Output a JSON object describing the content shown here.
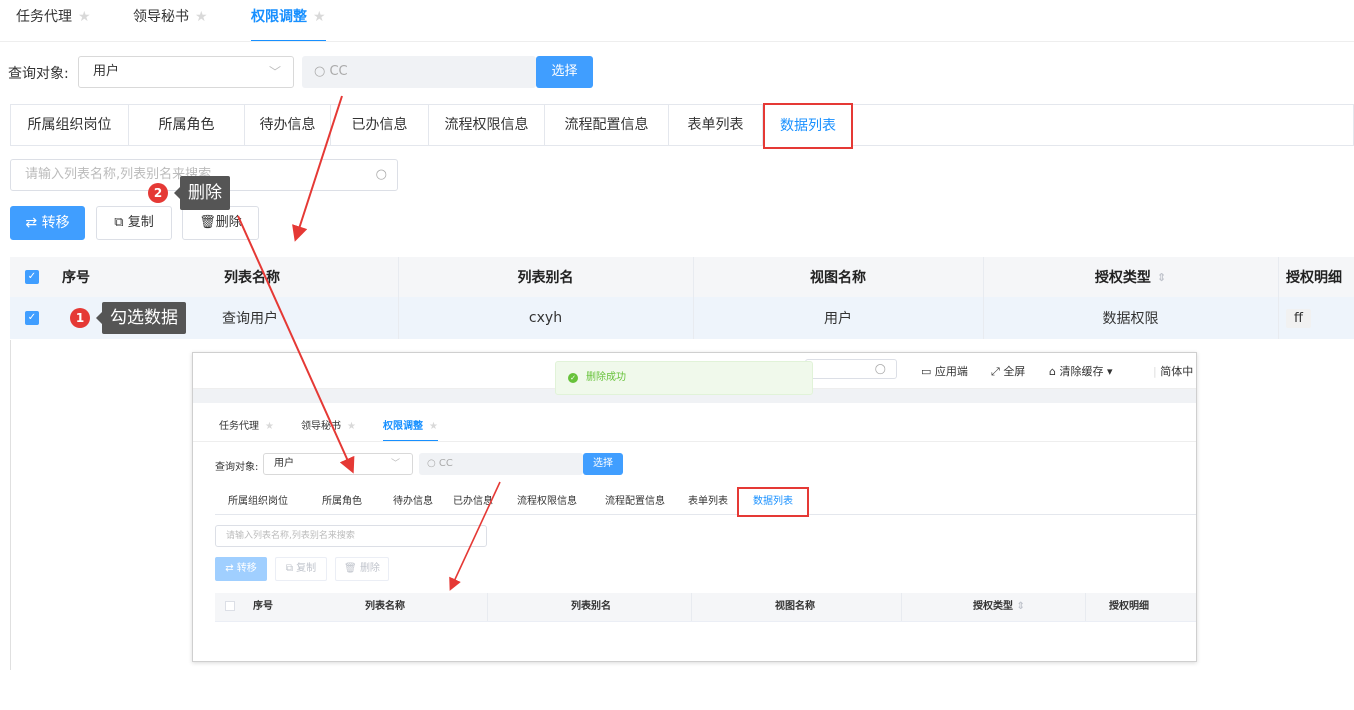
{
  "main": {
    "tabs": [
      {
        "label": "任务代理",
        "active": false
      },
      {
        "label": "领导秘书",
        "active": false
      },
      {
        "label": "权限调整",
        "active": true
      }
    ],
    "query": {
      "label": "查询对象:",
      "select_value": "用户",
      "search_value": "CC",
      "choose_button": "选择"
    },
    "subtabs": [
      "所属组织岗位",
      "所属角色",
      "待办信息",
      "已办信息",
      "流程权限信息",
      "流程配置信息",
      "表单列表",
      "数据列表"
    ],
    "active_subtab": "数据列表",
    "filter_placeholder": "请输入列表名称,列表别名来搜索",
    "actions": {
      "transfer": "转移",
      "copy": "复制",
      "delete": "删除"
    },
    "table": {
      "headers": [
        "序号",
        "列表名称",
        "列表别名",
        "视图名称",
        "授权类型",
        "授权明细"
      ],
      "rows": [
        {
          "name": "查询用户",
          "alias": "cxyh",
          "view": "用户",
          "auth_type": "数据权限",
          "auth_detail": "ff",
          "checked": true
        }
      ]
    },
    "annotations": [
      {
        "number": "1",
        "text": "勾选数据"
      },
      {
        "number": "2",
        "text": "删除"
      }
    ],
    "colors": {
      "primary": "#409eff",
      "highlight": "#e53935",
      "active_tab": "#1890ff"
    }
  },
  "inset": {
    "toolbar": {
      "app": "应用端",
      "fullscreen": "全屏",
      "clear_cache": "清除缓存",
      "lang": "简体中"
    },
    "toast": "删除成功",
    "tabs": [
      "任务代理",
      "领导秘书",
      "权限调整"
    ],
    "query": {
      "label": "查询对象:",
      "select_value": "用户",
      "search_value": "CC",
      "choose_button": "选择"
    },
    "subtabs": [
      "所属组织岗位",
      "所属角色",
      "待办信息",
      "已办信息",
      "流程权限信息",
      "流程配置信息",
      "表单列表",
      "数据列表"
    ],
    "filter_placeholder": "请输入列表名称,列表别名来搜索",
    "actions": {
      "transfer": "转移",
      "copy": "复制",
      "delete": "删除"
    },
    "headers": [
      "序号",
      "列表名称",
      "列表别名",
      "视图名称",
      "授权类型",
      "授权明细"
    ]
  }
}
